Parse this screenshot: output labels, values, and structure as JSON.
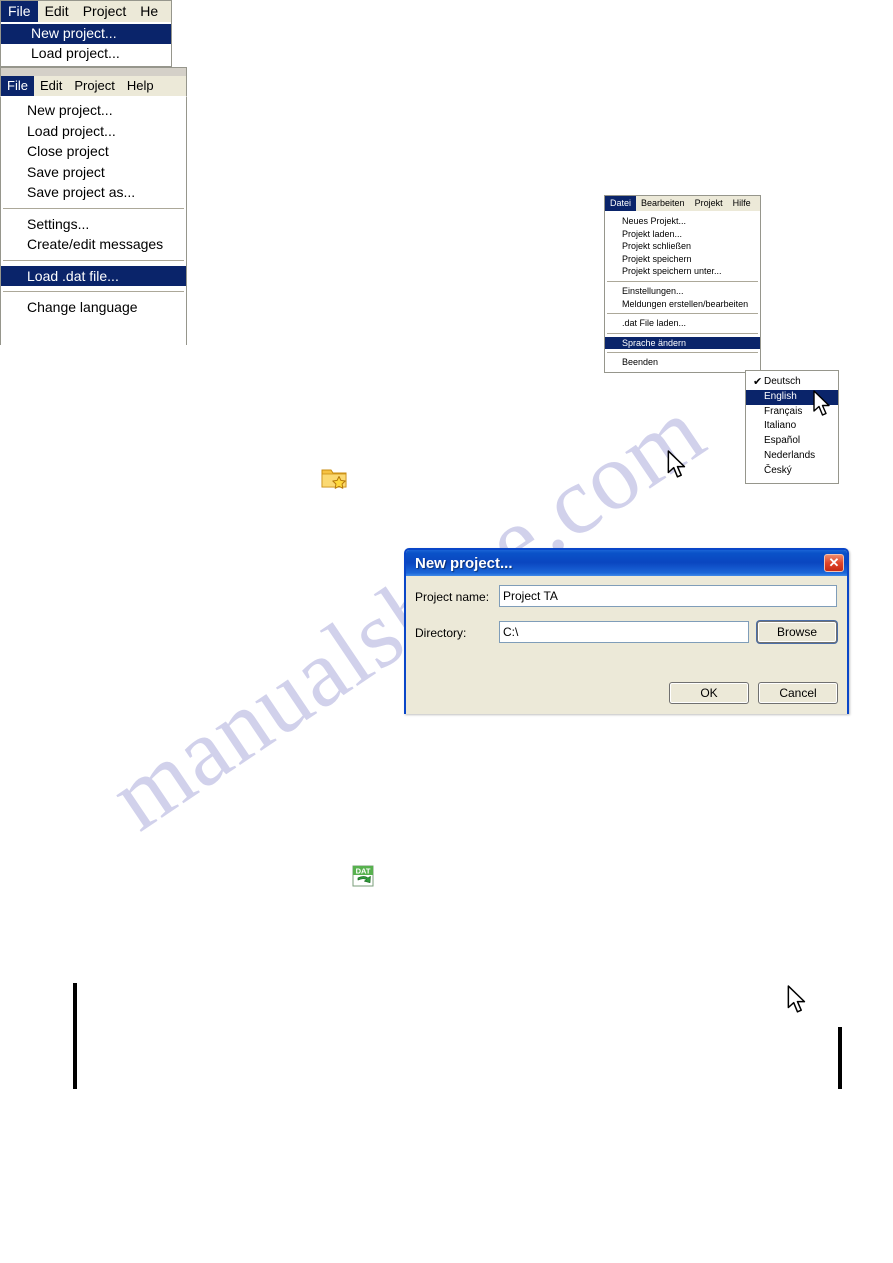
{
  "page": {
    "watermark": "manualshine.com",
    "background": "#ffffff"
  },
  "colors": {
    "menu_highlight": "#0a246a",
    "menubar_face": "#ece9d8",
    "dialog_face": "#ece9d8",
    "title_blue": "#0a46c0",
    "close_red": "#e0452a",
    "menu_border": "#96968c"
  },
  "german_menu": {
    "menubar": [
      "Datei",
      "Bearbeiten",
      "Projekt",
      "Hilfe"
    ],
    "selected_menubar": "Datei",
    "items": [
      {
        "label": "Neues Projekt...",
        "type": "item"
      },
      {
        "label": "Projekt laden...",
        "type": "item"
      },
      {
        "label": "Projekt schließen",
        "type": "item"
      },
      {
        "label": "Projekt speichern",
        "type": "item"
      },
      {
        "label": "Projekt speichern unter...",
        "type": "item"
      },
      {
        "label": "",
        "type": "separator"
      },
      {
        "label": "Einstellungen...",
        "type": "item"
      },
      {
        "label": "Meldungen erstellen/bearbeiten",
        "type": "item"
      },
      {
        "label": "",
        "type": "separator"
      },
      {
        "label": ".dat File laden...",
        "type": "item"
      },
      {
        "label": "",
        "type": "separator"
      },
      {
        "label": "Sprache ändern",
        "type": "item",
        "selected": true
      },
      {
        "label": "",
        "type": "separator"
      },
      {
        "label": "Beenden",
        "type": "item"
      }
    ]
  },
  "language_submenu": {
    "items": [
      {
        "label": "Deutsch",
        "checked": true
      },
      {
        "label": "English",
        "selected": true
      },
      {
        "label": "Français"
      },
      {
        "label": "Italiano"
      },
      {
        "label": "Español"
      },
      {
        "label": "Nederlands"
      },
      {
        "label": "Český"
      }
    ],
    "check_glyph": "✔"
  },
  "english_menu_middle": {
    "menubar": [
      "File",
      "Edit",
      "Project",
      "He"
    ],
    "selected_menubar": "File",
    "items": [
      {
        "label": "New project...",
        "selected": true
      },
      {
        "label": "Load project..."
      }
    ]
  },
  "english_menu_bottom": {
    "menubar": [
      "File",
      "Edit",
      "Project",
      "Help"
    ],
    "selected_menubar": "File",
    "items": [
      {
        "label": "New project...",
        "type": "item"
      },
      {
        "label": "Load project...",
        "type": "item"
      },
      {
        "label": "Close project",
        "type": "item"
      },
      {
        "label": "Save project",
        "type": "item"
      },
      {
        "label": "Save project as...",
        "type": "item"
      },
      {
        "label": "",
        "type": "separator"
      },
      {
        "label": "Settings...",
        "type": "item"
      },
      {
        "label": "Create/edit messages",
        "type": "item"
      },
      {
        "label": "",
        "type": "separator"
      },
      {
        "label": "Load .dat file...",
        "type": "item",
        "selected": true
      },
      {
        "label": "",
        "type": "separator"
      },
      {
        "label": "Change language",
        "type": "item"
      }
    ]
  },
  "dialog": {
    "title": "New project...",
    "close_glyph": "✕",
    "fields": [
      {
        "label": "Project name:",
        "value": "Project TA",
        "placeholder": ""
      },
      {
        "label": "Directory:",
        "value": "C:\\",
        "placeholder": ""
      }
    ],
    "browse_label": "Browse",
    "ok_label": "OK",
    "cancel_label": "Cancel"
  },
  "icons": {
    "new_project": {
      "name": "folder-star-icon",
      "caption": ""
    },
    "load_dat": {
      "name": "dat-file-download-icon",
      "caption": "DAT"
    }
  }
}
